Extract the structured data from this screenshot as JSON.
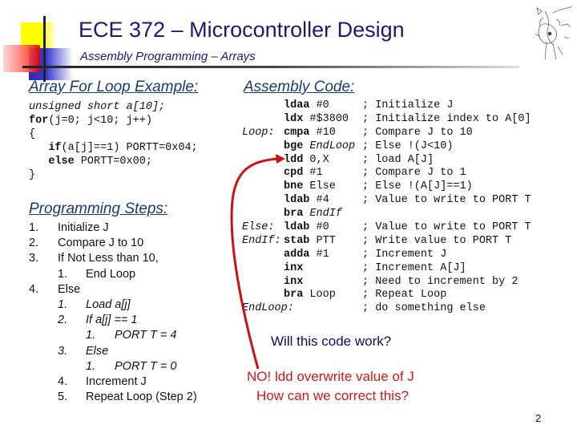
{
  "header": {
    "title": "ECE 372 – Microcontroller Design",
    "subtitle": "Assembly Programming – Arrays"
  },
  "left": {
    "example_heading": "Array For Loop Example:",
    "c_code": [
      {
        "kw": "",
        "rest": "unsigned short a[10];",
        "italic_part": "unsigned short"
      },
      {
        "kw": "for",
        "rest": "(j=0; j<10; j++)"
      },
      {
        "kw": "",
        "rest": "{"
      },
      {
        "kw": "if",
        "rest": "(a[j]==1) PORTT=0x04;",
        "indent": "   "
      },
      {
        "kw": "else",
        "rest": " PORTT=0x00;",
        "indent": "   "
      },
      {
        "kw": "",
        "rest": "}"
      }
    ],
    "steps_heading": "Programming Steps:",
    "steps": [
      {
        "num": "1.",
        "text": "Initialize J",
        "level": 0,
        "italic": false
      },
      {
        "num": "2.",
        "text": "Compare J to 10",
        "level": 0,
        "italic": false
      },
      {
        "num": "3.",
        "text": "If Not Less than 10,",
        "level": 0,
        "italic": false
      },
      {
        "num": "1.",
        "text": "End Loop",
        "level": 1,
        "italic": false
      },
      {
        "num": "4.",
        "text": "Else",
        "level": 0,
        "italic": false
      },
      {
        "num": "1.",
        "text": "Load a[j]",
        "level": 1,
        "italic": true
      },
      {
        "num": "2.",
        "text": "If a[j] == 1",
        "level": 1,
        "italic": true
      },
      {
        "num": "1.",
        "text": "PORT T = 4",
        "level": 2,
        "italic": true
      },
      {
        "num": "3.",
        "text": "Else",
        "level": 1,
        "italic": true
      },
      {
        "num": "1.",
        "text": "PORT T = 0",
        "level": 2,
        "italic": true
      },
      {
        "num": "4.",
        "text": "Increment J",
        "level": 1,
        "italic": false
      },
      {
        "num": "5.",
        "text": "Repeat Loop (Step 2)",
        "level": 1,
        "italic": false
      }
    ]
  },
  "right": {
    "asm_heading": "Assembly Code:",
    "asm_block1": [
      {
        "label": "",
        "op": "ldaa",
        "arg": "#0",
        "arg_italic": false,
        "comment": "; Initialize J"
      },
      {
        "label": "",
        "op": "ldx",
        "arg": "#$3800",
        "arg_italic": false,
        "comment": "; Initialize index to A[0]"
      },
      {
        "label": "Loop:",
        "op": "cmpa",
        "arg": "#10",
        "arg_italic": false,
        "comment": "; Compare J to 10"
      },
      {
        "label": "",
        "op": "bge",
        "arg": "EndLoop",
        "arg_italic": true,
        "comment": "; Else !(J<10)"
      },
      {
        "label": "",
        "op": "ldd",
        "arg": "0,X",
        "arg_italic": false,
        "comment": "; load A[J]"
      },
      {
        "label": "",
        "op": "cpd",
        "arg": "#1",
        "arg_italic": false,
        "comment": "; Compare J to 1"
      },
      {
        "label": "",
        "op": "bne",
        "arg": "Else",
        "arg_italic": false,
        "comment": "; Else !(A[J]==1)"
      },
      {
        "label": "",
        "op": "ldab",
        "arg": "#4",
        "arg_italic": false,
        "comment": "; Value to write to PORT T"
      },
      {
        "label": "",
        "op": "bra",
        "arg": "EndIf",
        "arg_italic": true,
        "comment": ""
      }
    ],
    "asm_block2": [
      {
        "label": "Else:",
        "op": "ldab",
        "arg": "#0",
        "arg_italic": false,
        "comment": "; Value to write to PORT T"
      },
      {
        "label": "EndIf:",
        "op": "stab",
        "arg": "PTT",
        "arg_italic": false,
        "comment": "; Write value to PORT T"
      },
      {
        "label": "",
        "op": "adda",
        "arg": "#1",
        "arg_italic": false,
        "comment": "; Increment J"
      },
      {
        "label": "",
        "op": "inx",
        "arg": "",
        "arg_italic": false,
        "comment": "; Increment A[J]"
      },
      {
        "label": "",
        "op": "inx",
        "arg": "",
        "arg_italic": false,
        "comment": "; Need to increment by 2"
      },
      {
        "label": "",
        "op": "bra",
        "arg": "Loop",
        "arg_italic": false,
        "comment": "; Repeat Loop"
      },
      {
        "label": "EndLoop:",
        "op": "",
        "arg": "",
        "arg_italic": false,
        "comment": "; do something else"
      }
    ],
    "question": "Will this code work?",
    "answer_line1": "NO! ldd overwrite value of J",
    "answer_line2": "How can we correct this?"
  },
  "footer": {
    "page_number": "2"
  },
  "colors": {
    "title": "#1a1a6e",
    "heading": "#1a3a6a",
    "answer_red": "#c81a1a",
    "arrow_red": "#cc1111"
  }
}
